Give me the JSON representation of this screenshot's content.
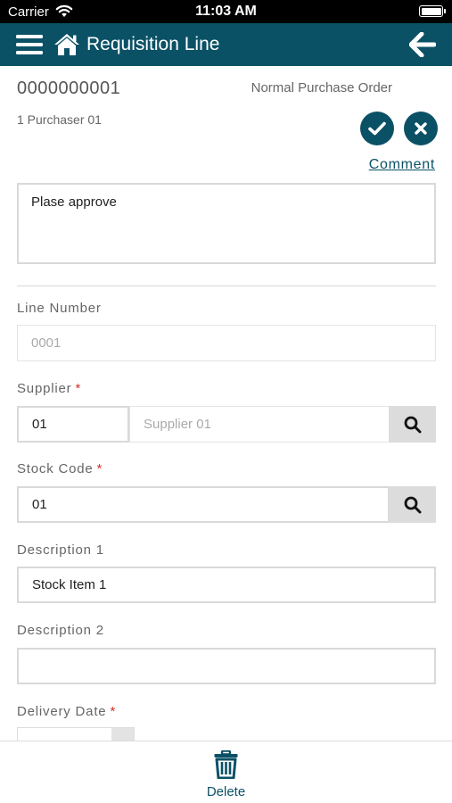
{
  "status_bar": {
    "carrier": "Carrier",
    "time": "11:03 AM",
    "battery_level": 1.0
  },
  "header": {
    "title": "Requisition Line",
    "background_color": "#0b5166",
    "icons": [
      "menu-icon",
      "home-icon",
      "back-arrow-icon"
    ]
  },
  "requisition": {
    "number": "0000000001",
    "order_type": "Normal Purchase Order",
    "purchaser": "1 Purchaser 01",
    "comment_link": "Comment",
    "comment_text": "Plase approve",
    "actions": [
      "check-icon",
      "close-icon"
    ]
  },
  "form": {
    "line_number": {
      "label": "Line Number",
      "value": "0001"
    },
    "supplier": {
      "label": "Supplier",
      "required_marker": "*",
      "code": "01",
      "name": "Supplier 01"
    },
    "stock_code": {
      "label": "Stock Code",
      "required_marker": "*",
      "value": "01"
    },
    "description_1": {
      "label": "Description 1",
      "value": "Stock Item 1"
    },
    "description_2": {
      "label": "Description 2",
      "value": ""
    },
    "delivery_date": {
      "label": "Delivery Date",
      "required_marker": "*",
      "value": ""
    }
  },
  "footer": {
    "delete_label": "Delete",
    "icon": "trash-icon"
  },
  "colors": {
    "primary": "#0b5166",
    "required": "#d0342c",
    "border": "#d9d9d9",
    "search_button": "#dcdcdc"
  }
}
